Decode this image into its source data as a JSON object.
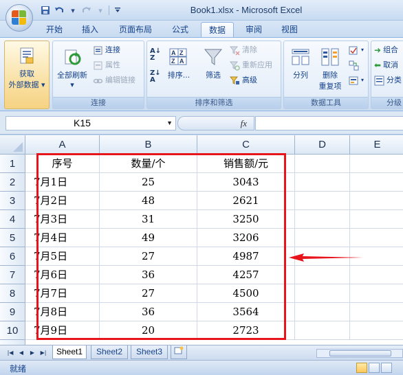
{
  "window": {
    "title": "Book1.xlsx - Microsoft Excel"
  },
  "quick_access": {
    "icons": [
      "save-icon",
      "undo-icon",
      "redo-icon",
      "customize-icon"
    ]
  },
  "ribbon_tabs": [
    "开始",
    "插入",
    "页面布局",
    "公式",
    "数据",
    "审阅",
    "视图"
  ],
  "active_tab": "数据",
  "ribbon": {
    "get_external": {
      "line1": "获取",
      "line2": "外部数据"
    },
    "refresh_all": "全部刷新",
    "connections": "连接",
    "properties": "属性",
    "edit_links": "编辑链接",
    "group_connections": "连接",
    "sort_az": "A Z",
    "sort_za": "Z A",
    "sort": "排序...",
    "filter": "筛选",
    "clear": "清除",
    "reapply": "重新应用",
    "advanced": "高级",
    "group_sort_filter": "排序和筛选",
    "text_to_columns": "分列",
    "remove_dup_line1": "删除",
    "remove_dup_line2": "重复项",
    "group_data_tools": "数据工具",
    "group_outline_btn1": "组合",
    "group_outline_btn2": "取消",
    "group_outline_btn3": "分类",
    "group_outline": "分级"
  },
  "formula_bar": {
    "name_box": "K15",
    "fx": "fx",
    "formula": ""
  },
  "columns": [
    "A",
    "B",
    "C",
    "D",
    "E"
  ],
  "rows": [
    "1",
    "2",
    "3",
    "4",
    "5",
    "6",
    "7",
    "8",
    "9",
    "10"
  ],
  "table": {
    "headers": [
      "序号",
      "数量/个",
      "销售额/元"
    ],
    "data": [
      [
        "7月1日",
        "25",
        "3043"
      ],
      [
        "7月2日",
        "48",
        "2621"
      ],
      [
        "7月3日",
        "31",
        "3250"
      ],
      [
        "7月4日",
        "49",
        "3206"
      ],
      [
        "7月5日",
        "27",
        "4987"
      ],
      [
        "7月6日",
        "36",
        "4257"
      ],
      [
        "7月7日",
        "27",
        "4500"
      ],
      [
        "7月8日",
        "36",
        "3564"
      ],
      [
        "7月9日",
        "20",
        "2723"
      ]
    ]
  },
  "sheets": [
    "Sheet1",
    "Sheet2",
    "Sheet3"
  ],
  "active_sheet": "Sheet1",
  "status": {
    "text": "就绪"
  },
  "colors": {
    "highlight_box": "#e8141c",
    "arrow": "#e8141c"
  }
}
